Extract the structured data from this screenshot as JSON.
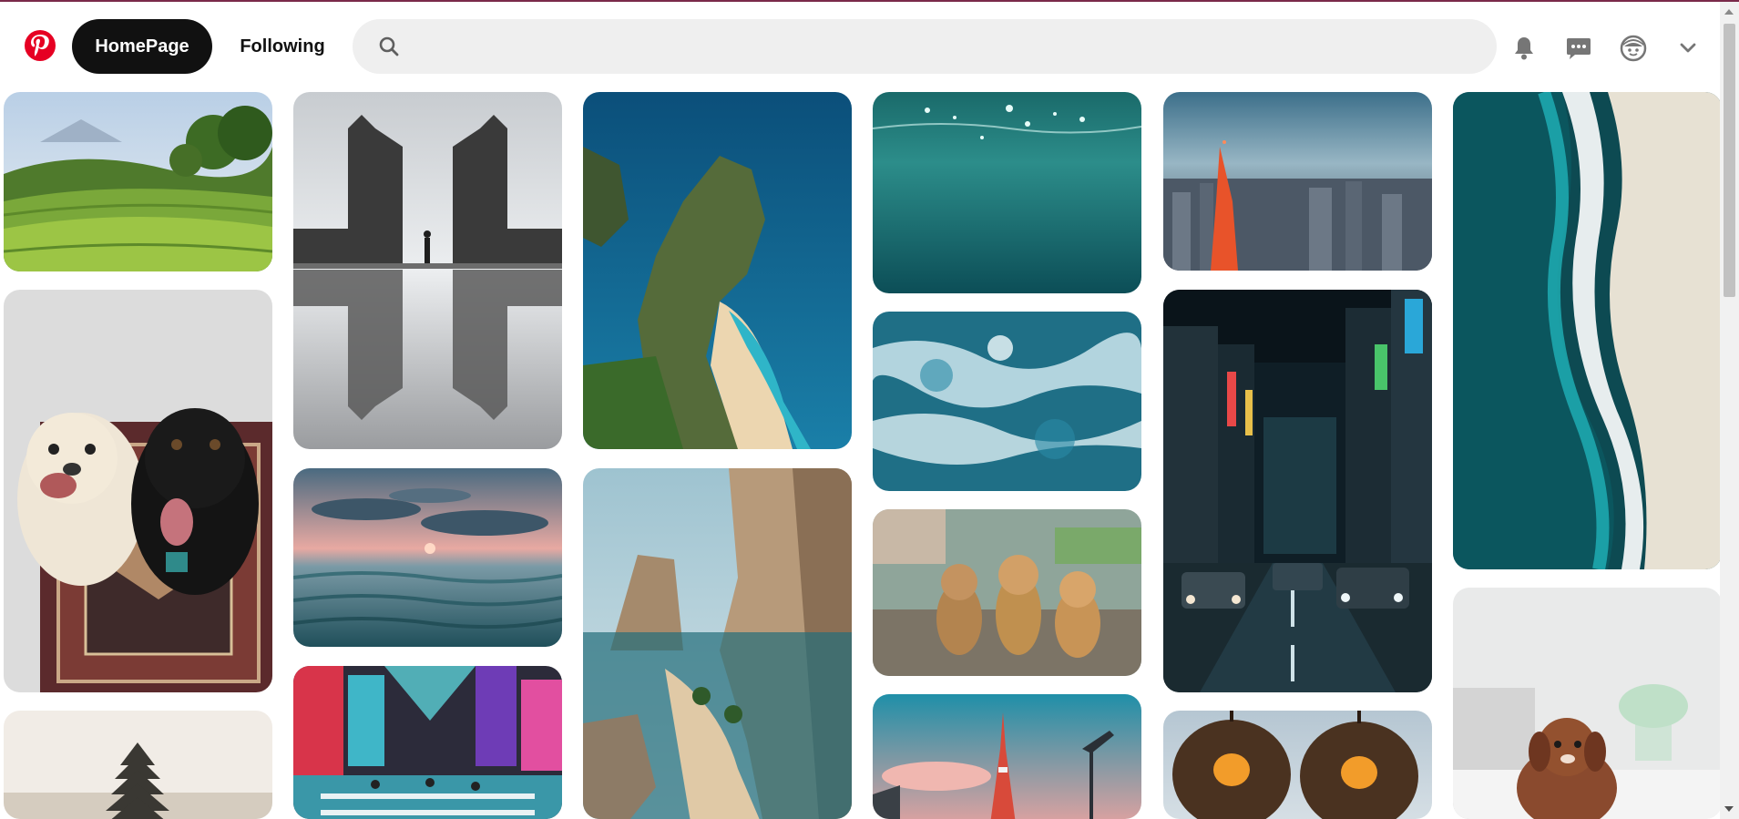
{
  "header": {
    "logo_icon": "pinterest-logo-icon",
    "nav": {
      "home_label": "HomePage",
      "following_label": "Following"
    },
    "search": {
      "icon": "search-icon",
      "value": "",
      "placeholder": ""
    },
    "icons": [
      "bell-icon",
      "chat-icon",
      "profile-face-icon",
      "chevron-down-icon"
    ]
  },
  "colors": {
    "brand": "#e60023",
    "active_nav_bg": "#111111",
    "search_bg": "#efefef"
  },
  "feed": {
    "pins": [
      {
        "name": "pin-rice-terraces",
        "subject": "rice-terraces"
      },
      {
        "name": "pin-two-dogs-on-rug",
        "subject": "two-dogs-on-rug"
      },
      {
        "name": "pin-temple-pagoda",
        "subject": "temple-pagoda"
      },
      {
        "name": "pin-temple-gate-reflection",
        "subject": "temple-gate-reflection"
      },
      {
        "name": "pin-ocean-sunset",
        "subject": "ocean-sunset"
      },
      {
        "name": "pin-neon-city-crossing",
        "subject": "neon-city-crossing"
      },
      {
        "name": "pin-cliff-coast-aerial",
        "subject": "cliff-coast-aerial"
      },
      {
        "name": "pin-sea-cliffs-beach",
        "subject": "sea-cliffs-beach"
      },
      {
        "name": "pin-underwater-surface",
        "subject": "underwater-surface"
      },
      {
        "name": "pin-sea-foam",
        "subject": "sea-foam"
      },
      {
        "name": "pin-three-puppies",
        "subject": "three-puppies"
      },
      {
        "name": "pin-tokyo-tower-sunset",
        "subject": "tokyo-tower-sunset"
      },
      {
        "name": "pin-tokyo-skyline",
        "subject": "tokyo-skyline"
      },
      {
        "name": "pin-night-street-neon",
        "subject": "night-street-neon"
      },
      {
        "name": "pin-rattan-lamps",
        "subject": "rattan-lamps"
      },
      {
        "name": "pin-beach-waves-aerial",
        "subject": "beach-waves-aerial"
      },
      {
        "name": "pin-puppy-on-bed",
        "subject": "puppy-on-bed"
      }
    ]
  }
}
